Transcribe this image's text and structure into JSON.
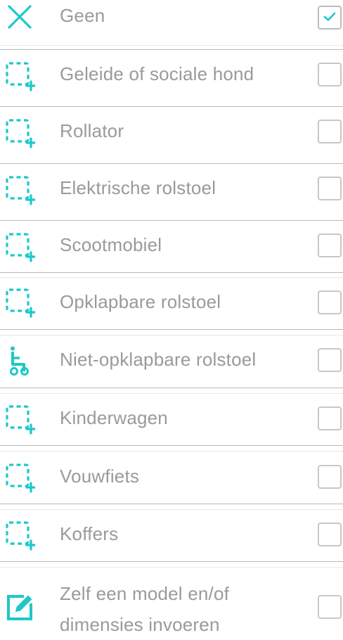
{
  "accent_color": "#1ec8c8",
  "items": [
    {
      "label": "Geen",
      "icon": "close-icon",
      "checked": true
    },
    {
      "label": "Geleide of sociale hond",
      "icon": "dashed-square-plus-icon",
      "checked": false
    },
    {
      "label": "Rollator",
      "icon": "dashed-square-plus-icon",
      "checked": false
    },
    {
      "label": "Elektrische rolstoel",
      "icon": "dashed-square-plus-icon",
      "checked": false
    },
    {
      "label": "Scootmobiel",
      "icon": "dashed-square-plus-icon",
      "checked": false
    },
    {
      "label": "Opklapbare rolstoel",
      "icon": "dashed-square-plus-icon",
      "checked": false
    },
    {
      "label": "Niet-opklapbare rolstoel",
      "icon": "wheelchair-icon",
      "checked": false
    },
    {
      "label": "Kinderwagen",
      "icon": "dashed-square-plus-icon",
      "checked": false
    },
    {
      "label": "Vouwfiets",
      "icon": "dashed-square-plus-icon",
      "checked": false
    },
    {
      "label": "Koffers",
      "icon": "dashed-square-plus-icon",
      "checked": false
    },
    {
      "label": "Zelf een model en/of dimensies invoeren",
      "icon": "edit-icon",
      "checked": false
    }
  ]
}
